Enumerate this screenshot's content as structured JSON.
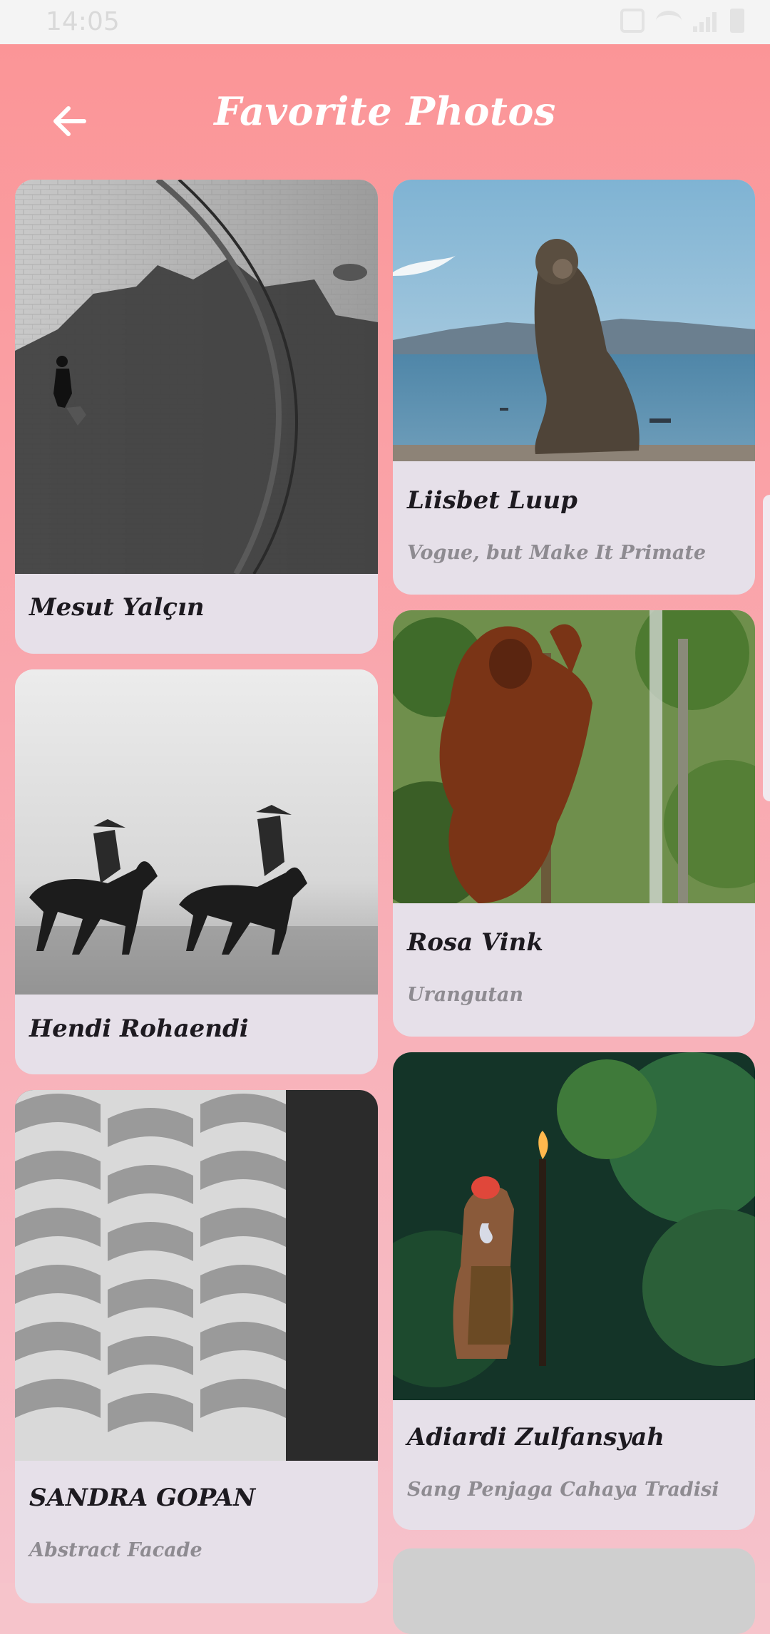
{
  "status_bar": {
    "time": "14:05",
    "icons": [
      "mute-icon",
      "wifi-icon",
      "signal-icon",
      "battery-icon"
    ]
  },
  "header": {
    "title": "Favorite Photos",
    "back_icon": "arrow-left-icon"
  },
  "colors": {
    "header_gradient_top": "#fb9597",
    "background_bottom": "#f6c2cb",
    "card_bg": "#e6e0e9",
    "title_text": "#ffffff",
    "name_text": "#1d1a20",
    "subtitle_text": "#8e8b91"
  },
  "photos": [
    {
      "name": "Mesut  Yalçın",
      "subtitle": ""
    },
    {
      "name": "Liisbet Luup",
      "subtitle": "Vogue, but Make It Primate"
    },
    {
      "name": "Hendi Rohaendi",
      "subtitle": ""
    },
    {
      "name": "Rosa Vink",
      "subtitle": "Urangutan"
    },
    {
      "name": "SANDRA GOPAN",
      "subtitle": "Abstract Facade"
    },
    {
      "name": "Adiardi Zulfansyah",
      "subtitle": "Sang Penjaga Cahaya Tradisi"
    }
  ]
}
